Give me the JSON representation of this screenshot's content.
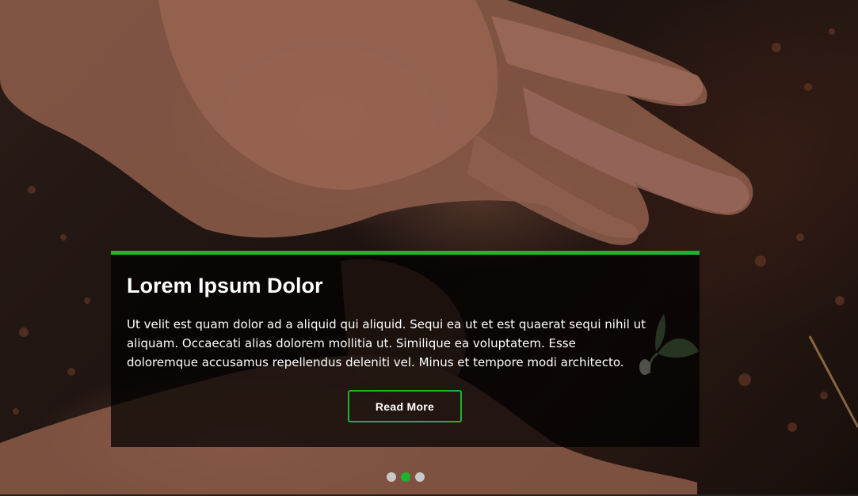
{
  "slide": {
    "title": "Lorem Ipsum Dolor",
    "body": "Ut velit est quam dolor ad a aliquid qui aliquid. Sequi ea ut et est quaerat sequi nihil ut aliquam. Occaecati alias dolorem mollitia ut. Similique ea voluptatem. Esse doloremque accusamus repellendus deleniti vel. Minus et tempore modi architecto.",
    "button_label": "Read More"
  },
  "pagination": {
    "count": 3,
    "active_index": 1
  },
  "colors": {
    "accent": "#1bb52f",
    "card_background": "rgba(0,0,0,0.72)",
    "text": "#ffffff",
    "dot_inactive": "#c9c9c9"
  },
  "background_image": {
    "subject": "hands-in-soil-photo"
  }
}
